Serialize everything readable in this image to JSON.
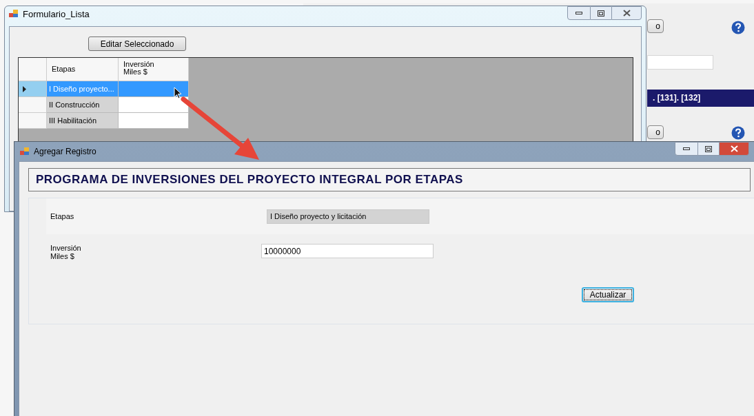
{
  "background_window": {
    "buttons": [
      "o",
      "o"
    ],
    "banner": ". [131]. [132]"
  },
  "list_window": {
    "title": "Formulario_Lista",
    "edit_button": "Editar Seleccionado",
    "table": {
      "columns": [
        "Etapas",
        "Inversión\nMiles $"
      ],
      "rows": [
        {
          "cells": [
            "I Diseño proyecto...",
            ""
          ],
          "selected": true
        },
        {
          "cells": [
            "II Construcción",
            ""
          ],
          "selected": false
        },
        {
          "cells": [
            "III Habilitación",
            ""
          ],
          "selected": false
        }
      ]
    }
  },
  "form_window": {
    "title": "Agregar Registro",
    "heading": "PROGRAMA DE INVERSIONES DEL PROYECTO INTEGRAL POR ETAPAS",
    "fields": [
      {
        "label": "Etapas",
        "value": "I Diseño proyecto y licitación",
        "kind": "readonly"
      },
      {
        "label": "Inversión\nMiles $",
        "value": "10000000",
        "kind": "input"
      }
    ],
    "button": "Actualizar"
  }
}
